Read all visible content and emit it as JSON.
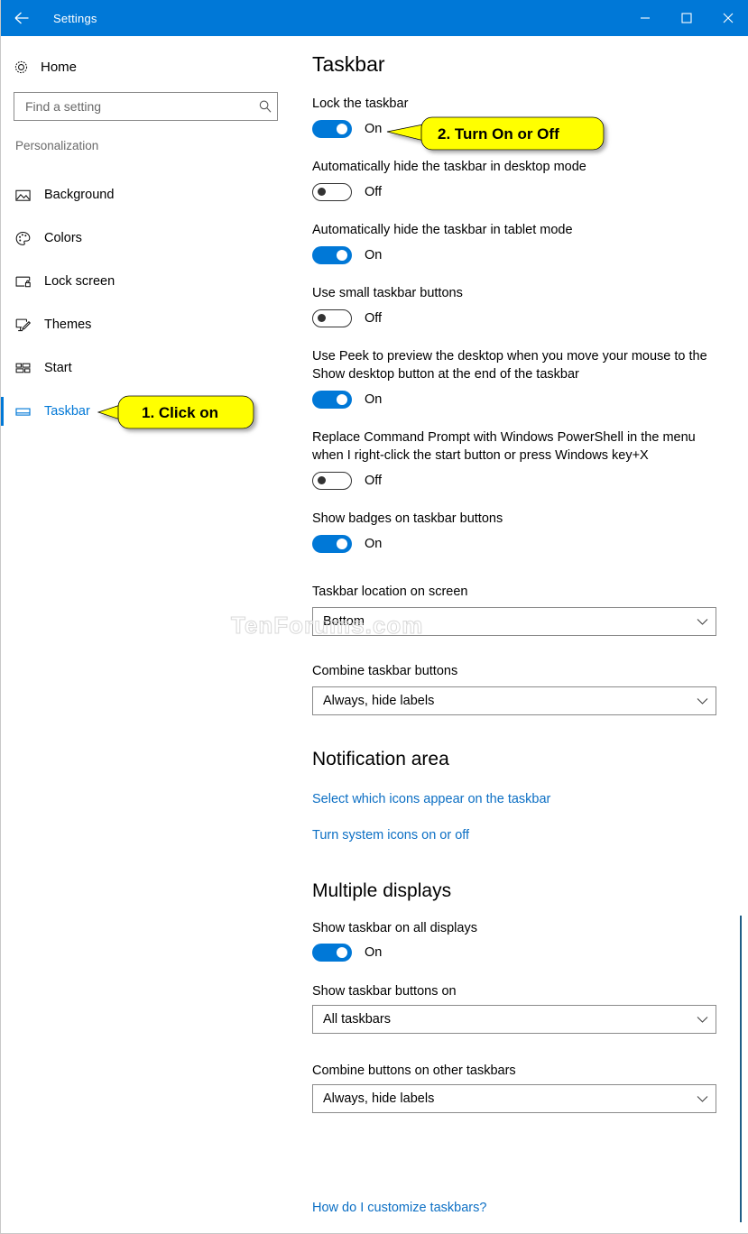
{
  "window": {
    "title": "Settings",
    "back_label": "back-arrow",
    "minimize_label": "Minimize",
    "maximize_label": "Maximize",
    "close_label": "Close",
    "accent_color": "#0078d7"
  },
  "sidebar": {
    "home_label": "Home",
    "search": {
      "placeholder": "Find a setting",
      "value": ""
    },
    "group_title": "Personalization",
    "items": [
      {
        "label": "Background",
        "icon": "picture-icon",
        "selected": false
      },
      {
        "label": "Colors",
        "icon": "palette-icon",
        "selected": false
      },
      {
        "label": "Lock screen",
        "icon": "lock-screen-icon",
        "selected": false
      },
      {
        "label": "Themes",
        "icon": "themes-brush-icon",
        "selected": false
      },
      {
        "label": "Start",
        "icon": "start-tiles-icon",
        "selected": false
      },
      {
        "label": "Taskbar",
        "icon": "taskbar-icon",
        "selected": true
      }
    ]
  },
  "main": {
    "page_title": "Taskbar",
    "settings": [
      {
        "label": "Lock the taskbar",
        "state": "On"
      },
      {
        "label": "Automatically hide the taskbar in desktop mode",
        "state": "Off"
      },
      {
        "label": "Automatically hide the taskbar in tablet mode",
        "state": "On"
      },
      {
        "label": "Use small taskbar buttons",
        "state": "Off"
      },
      {
        "label": "Use Peek to preview the desktop when you move your mouse to the Show desktop button at the end of the taskbar",
        "state": "On"
      },
      {
        "label": "Replace Command Prompt with Windows PowerShell in the menu when I right-click the start button or press Windows key+X",
        "state": "Off"
      },
      {
        "label": "Show badges on taskbar buttons",
        "state": "On"
      }
    ],
    "dropdowns": [
      {
        "label": "Taskbar location on screen",
        "value": "Bottom"
      },
      {
        "label": "Combine taskbar buttons",
        "value": "Always, hide labels"
      }
    ],
    "notification_area": {
      "heading": "Notification area",
      "links": [
        "Select which icons appear on the taskbar",
        "Turn system icons on or off"
      ]
    },
    "multiple_displays": {
      "heading": "Multiple displays",
      "toggle": {
        "label": "Show taskbar on all displays",
        "state": "On"
      },
      "dropdowns": [
        {
          "label": "Show taskbar buttons on",
          "value": "All taskbars"
        },
        {
          "label": "Combine buttons on other taskbars",
          "value": "Always, hide labels"
        }
      ]
    },
    "footer_link": "How do I customize taskbars?"
  },
  "callouts": {
    "step1": "1. Click on",
    "step2": "2. Turn On or Off",
    "fill_color": "#ffff00"
  },
  "watermark": {
    "text": "TenForums.com"
  }
}
